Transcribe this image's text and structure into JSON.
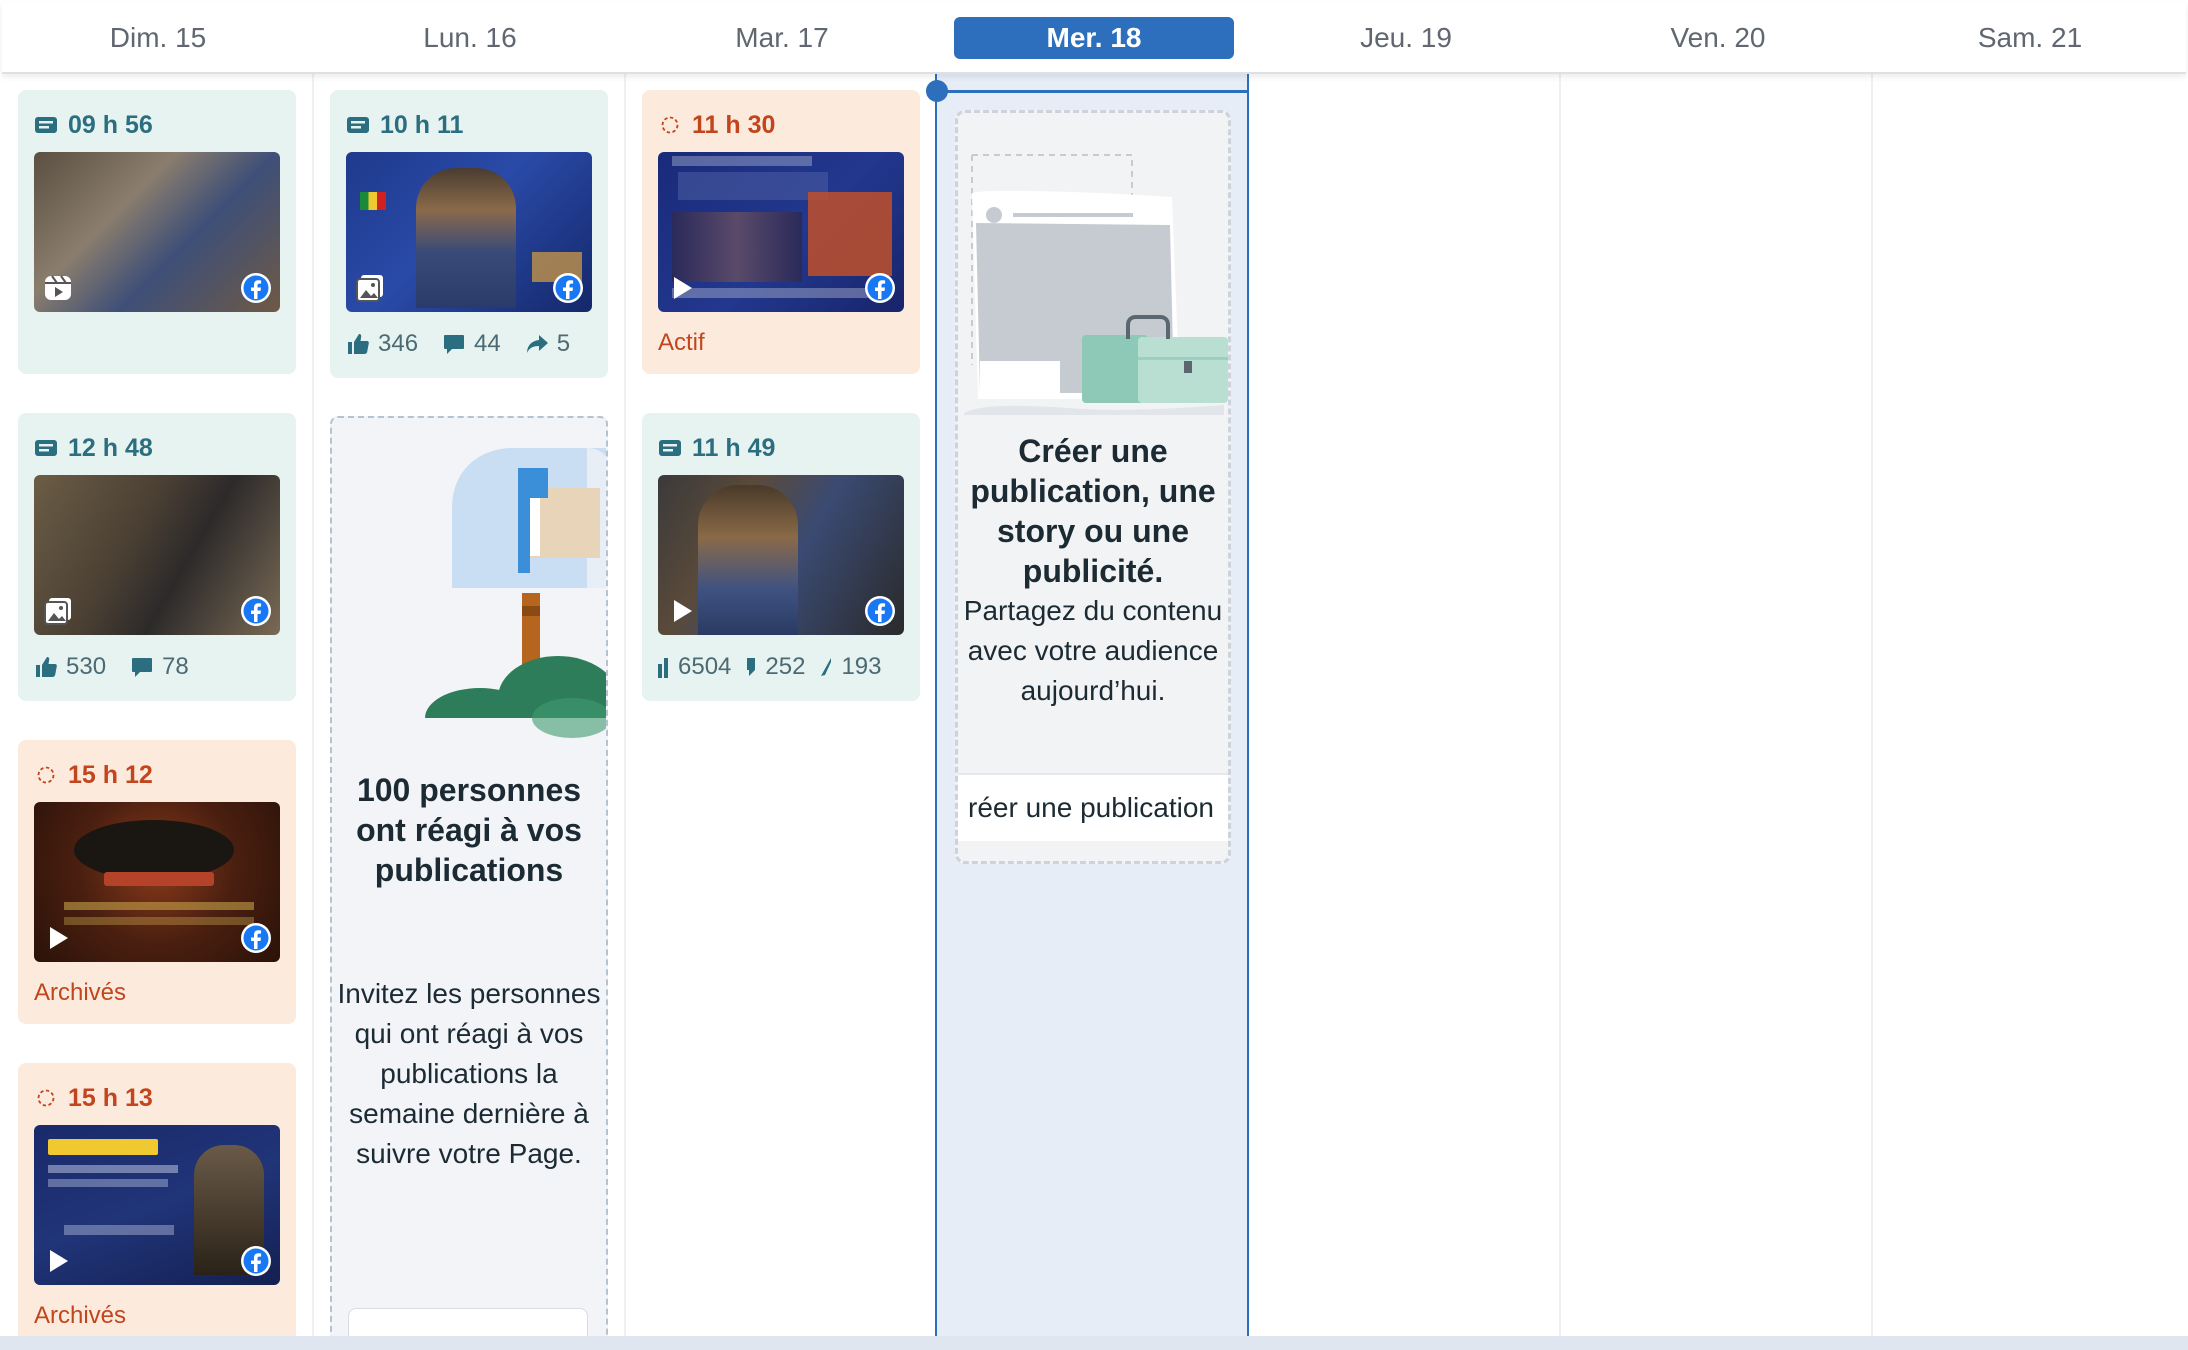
{
  "colors": {
    "accent": "#2e6fbd",
    "published_bg": "#e7f3f0",
    "published_text": "#2b6e7f",
    "scheduled_bg": "#fcebdc",
    "scheduled_text": "#c2451e",
    "today_bg": "#e6edf6"
  },
  "days": [
    {
      "label": "Dim. 15"
    },
    {
      "label": "Lun. 16"
    },
    {
      "label": "Mar. 17"
    },
    {
      "label": "Mer. 18",
      "today": true
    },
    {
      "label": "Jeu. 19"
    },
    {
      "label": "Ven. 20"
    },
    {
      "label": "Sam. 21"
    }
  ],
  "posts": {
    "dim_1": {
      "time": "09 h 56",
      "status": "published",
      "type_icon": "reel-icon"
    },
    "dim_2": {
      "time": "12 h 48",
      "status": "published",
      "type_icon": "photo-icon",
      "likes": "530",
      "comments": "78"
    },
    "dim_3": {
      "time": "15 h 12",
      "status": "scheduled",
      "type_icon": "video-icon",
      "state": "Archivés"
    },
    "dim_4": {
      "time": "15 h 13",
      "status": "scheduled",
      "type_icon": "video-icon",
      "state": "Archivés"
    },
    "lun_1": {
      "time": "10 h 11",
      "status": "published",
      "type_icon": "photo-icon",
      "likes": "346",
      "comments": "44",
      "shares": "5"
    },
    "mar_1": {
      "time": "11 h 30",
      "status": "scheduled",
      "type_icon": "video-icon",
      "state": "Actif"
    },
    "mar_2": {
      "time": "11 h 49",
      "status": "published",
      "type_icon": "video-icon",
      "likes": "6504",
      "comments": "252",
      "shares": "193"
    }
  },
  "promo": {
    "title": "100 personnes ont réagi à vos publications",
    "body": "Invitez les personnes qui ont réagi à vos publications la semaine dernière à suivre votre Page."
  },
  "create": {
    "title": "Créer une publication, une story ou une publicité.",
    "body": "Partagez du contenu avec votre audience aujourd’hui.",
    "button": "réer une publication"
  }
}
